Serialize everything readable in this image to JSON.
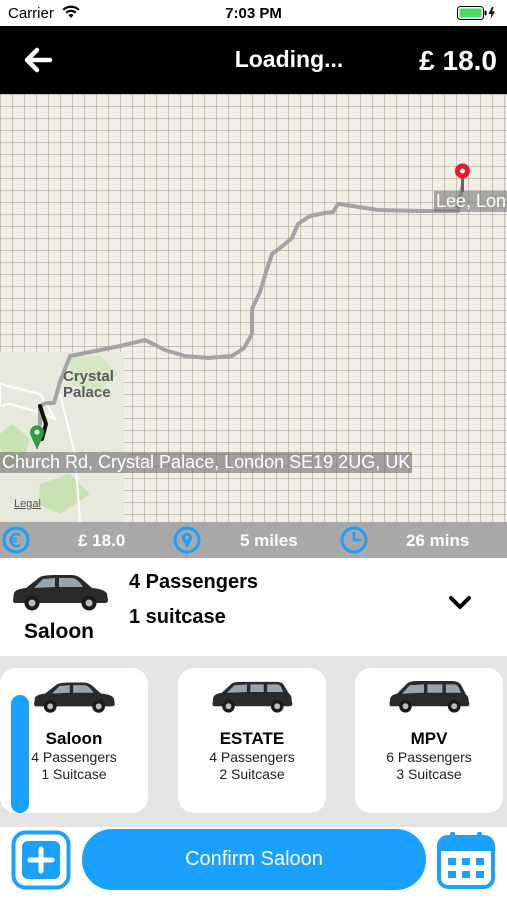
{
  "status_bar": {
    "carrier": "Carrier",
    "time": "7:03 PM"
  },
  "nav": {
    "title": "Loading...",
    "price": "£ 18.0"
  },
  "map": {
    "area_label_line1": "Crystal",
    "area_label_line2": "Palace",
    "legal": "Legal",
    "destination_label": "Lee, Lon",
    "origin_label": "Church Rd, Crystal Palace, London SE19 2UG, UK"
  },
  "trip_info": {
    "fare": "£ 18.0",
    "distance": "5 miles",
    "duration": "26 mins"
  },
  "selected_vehicle": {
    "name": "Saloon",
    "passengers": "4 Passengers",
    "luggage": "1 suitcase"
  },
  "vehicle_options": [
    {
      "name": "Saloon",
      "passengers": "4 Passengers",
      "luggage": "1 Suitcase"
    },
    {
      "name": "ESTATE",
      "passengers": "4 Passengers",
      "luggage": "2 Suitcase"
    },
    {
      "name": "MPV",
      "passengers": "6 Passengers",
      "luggage": "3 Suitcase"
    }
  ],
  "actions": {
    "confirm_label": "Confirm Saloon"
  },
  "colors": {
    "accent": "#1aa1ff",
    "nav_background": "#000000",
    "info_strip": "#a8a8a8",
    "route": "#a0a0a0",
    "destination_pin": "#e8192c",
    "origin_pin": "#2e9e46"
  },
  "icons": {
    "back": "arrow-left-icon",
    "fare": "euro-icon",
    "distance": "location-pin-icon",
    "duration": "clock-icon",
    "vehicle": "car-icon",
    "expand": "chevron-down-icon",
    "add": "plus-icon",
    "schedule": "calendar-icon"
  }
}
